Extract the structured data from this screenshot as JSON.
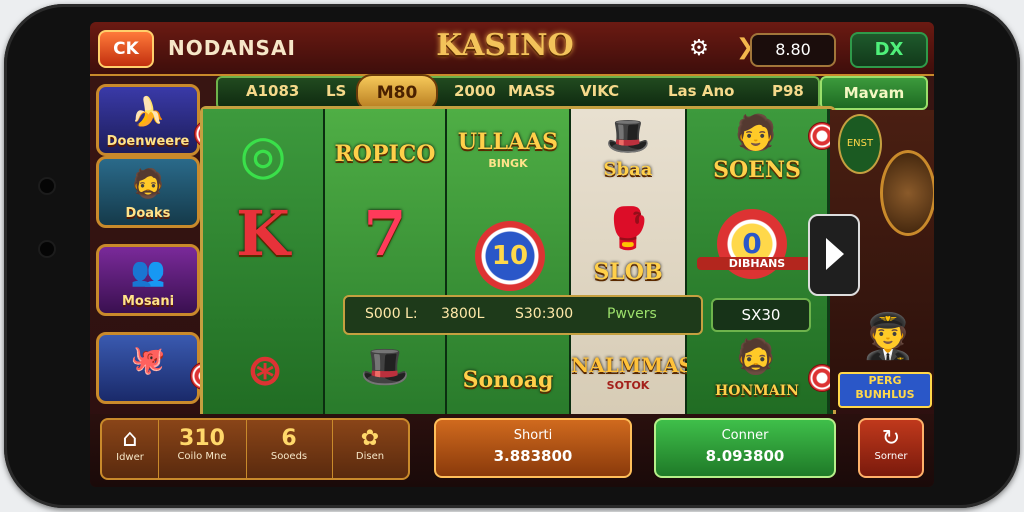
{
  "topbar": {
    "logo": "CK",
    "brand": "NODANSAI",
    "title": "KASINO",
    "balance": "8.80",
    "dx": "DX"
  },
  "tabs": {
    "items": [
      "A1083",
      "LS",
      "2000",
      "MASS",
      "VIKC",
      "Las Ano",
      "P98"
    ],
    "active": "M80",
    "side_button": "Mavam"
  },
  "left_panel": {
    "items": [
      {
        "label": "Doenweere"
      },
      {
        "label": "Doaks"
      },
      {
        "label": "Mosani"
      },
      {
        "label": ""
      }
    ]
  },
  "reels": {
    "row1": [
      "",
      "ROPICO",
      "ULLAAS",
      "Sbaa",
      "SOENS"
    ],
    "row2": [
      "K",
      "7",
      "10",
      "SLOB",
      ""
    ],
    "row3": [
      "",
      "",
      "Sonoag",
      "NALMMAS",
      "HONMAIN"
    ],
    "reel3_sub": "BINGK",
    "reel5_mid": "DIBHANS",
    "nalmmas_sub": "SOTOK"
  },
  "payline": {
    "v1": "S000 L:",
    "v2": "3800L",
    "v3": "S30:300",
    "label": "Pwvers",
    "side": "SX30"
  },
  "right_panel": {
    "sign": "ENST",
    "card": "PERG BUNHLUS"
  },
  "bottom": {
    "home_label": "Idwer",
    "stat1_value": "310",
    "stat1_label": "Coilo Mne",
    "stat2_value": "6",
    "stat2_label": "Sooeds",
    "stat3_label": "Disen",
    "orange_title": "Shorti",
    "orange_value": "3.883800",
    "green_title": "Conner",
    "green_value": "8.093800",
    "last_label": "Sorner"
  },
  "colors": {
    "gold": "#f3c35a",
    "green_accent": "#4ff07a",
    "orange_btn": "#d06a1e",
    "green_btn": "#3fbf4a"
  }
}
